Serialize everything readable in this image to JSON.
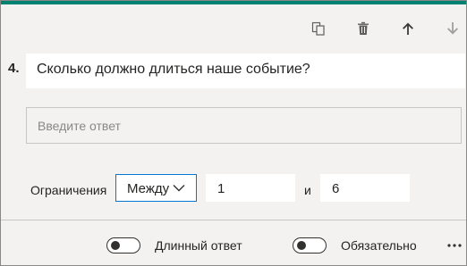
{
  "colors": {
    "accent": "#008272",
    "focus_border": "#0078d4",
    "panel_bg": "#f3f2f1",
    "field_bg": "#ffffff",
    "text": "#252423",
    "placeholder": "#8a8886"
  },
  "toolbar": {
    "icons": [
      "copy-icon",
      "delete-icon",
      "move-up-icon",
      "move-down-icon"
    ]
  },
  "question": {
    "number": "4.",
    "text": "Сколько должно длиться наше событие?"
  },
  "answer": {
    "placeholder": "Введите ответ"
  },
  "restrictions": {
    "label": "Ограничения",
    "operator": "Между",
    "min_value": "1",
    "and_label": "и",
    "max_value": "6"
  },
  "footer": {
    "long_answer_label": "Длинный ответ",
    "long_answer_on": false,
    "required_label": "Обязательно",
    "required_on": false,
    "more_icon": "more-icon"
  }
}
